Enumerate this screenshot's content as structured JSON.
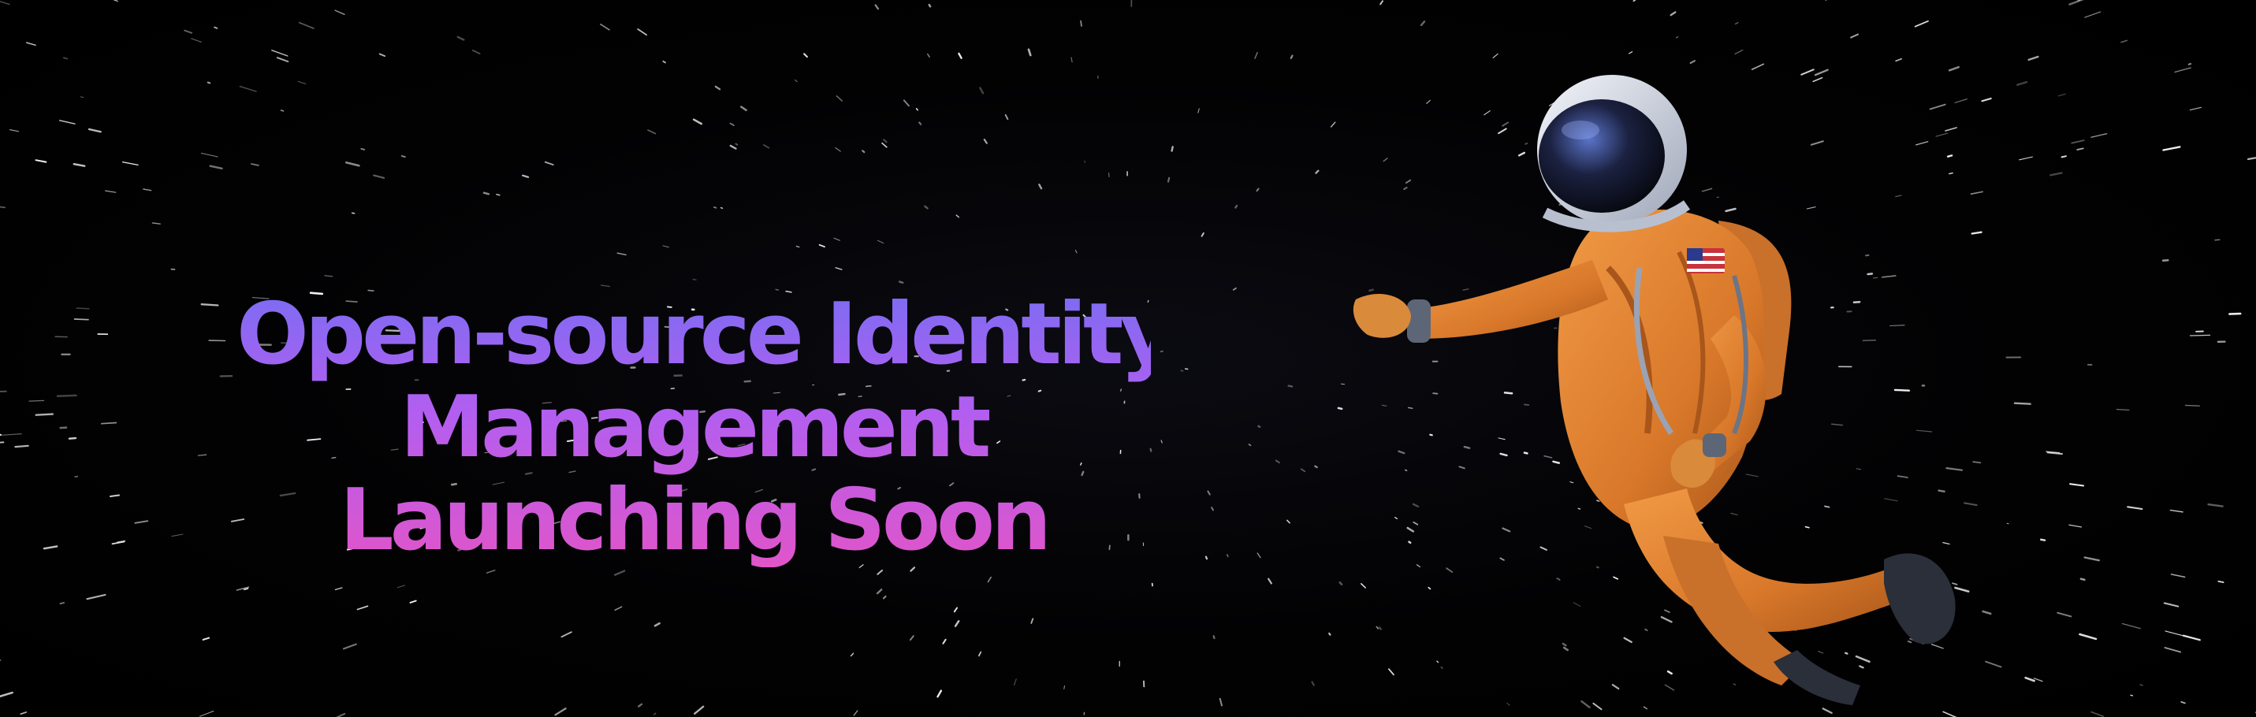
{
  "hero": {
    "headline_lines": [
      "Open-source Identity",
      "Management",
      "Launching Soon"
    ],
    "gradient_colors": [
      "#7c6cf2",
      "#b35ef0",
      "#e055c9"
    ],
    "background_color": "#000000",
    "illustration": "astronaut-illustration"
  }
}
